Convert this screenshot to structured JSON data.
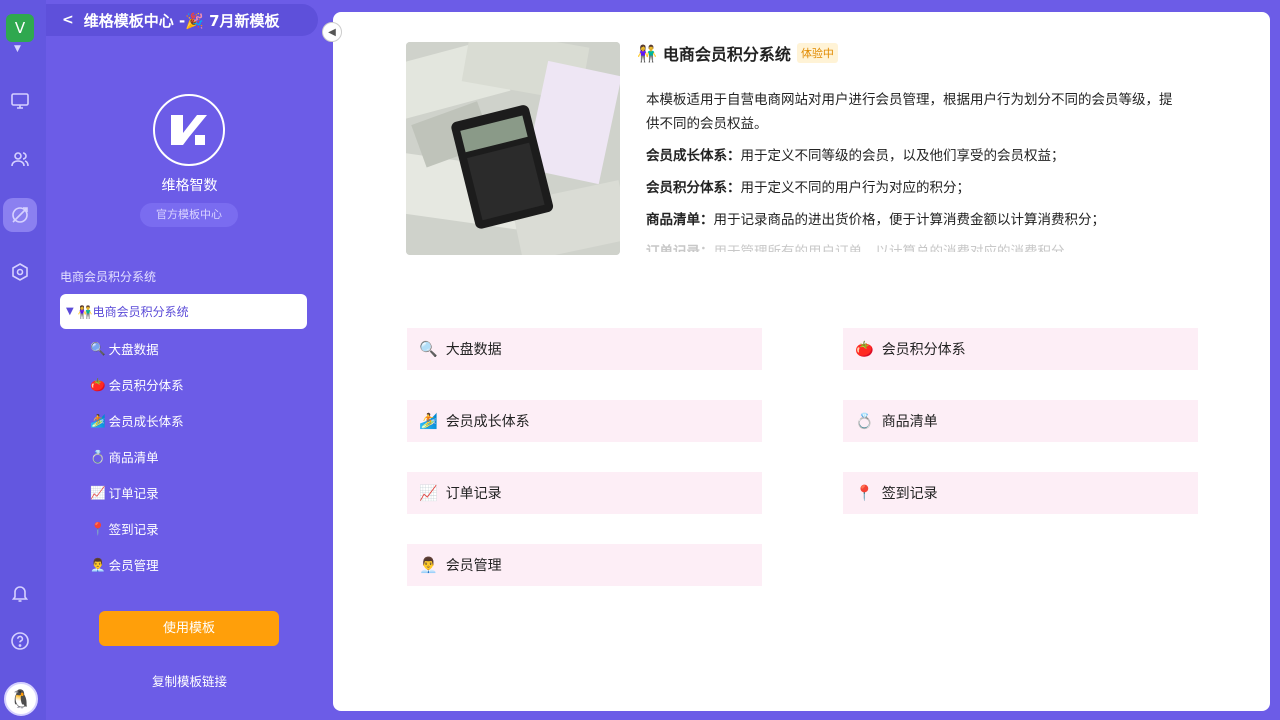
{
  "rail": {
    "workspace_initial": "V"
  },
  "side": {
    "title": "维格模板中心 -🎉 7月新模板",
    "brand_name": "维格智数",
    "brand_tag": "官方模板中心",
    "section_label": "电商会员积分系统",
    "tree_root": "电商会员积分系统",
    "tree_root_icon": "👫",
    "items": [
      {
        "icon": "🔍",
        "label": "大盘数据"
      },
      {
        "icon": "🍅",
        "label": "会员积分体系"
      },
      {
        "icon": "🏄",
        "label": "会员成长体系"
      },
      {
        "icon": "💍",
        "label": "商品清单"
      },
      {
        "icon": "📈",
        "label": "订单记录"
      },
      {
        "icon": "📍",
        "label": "签到记录"
      },
      {
        "icon": "👨‍💼",
        "label": "会员管理"
      }
    ],
    "use_button": "使用模板",
    "copy_link": "复制模板链接"
  },
  "main": {
    "title_icon": "👫",
    "title": "电商会员积分系统",
    "badge": "体验中",
    "intro": "本模板适用于自营电商网站对用户进行会员管理，根据用户行为划分不同的会员等级，提供不同的会员权益。",
    "features": [
      {
        "name": "会员成长体系：",
        "text": "用于定义不同等级的会员，以及他们享受的会员权益；"
      },
      {
        "name": "会员积分体系：",
        "text": "用于定义不同的用户行为对应的积分；"
      },
      {
        "name": "商品清单：",
        "text": "用于记录商品的进出货价格，便于计算消费金额以计算消费积分；"
      },
      {
        "name": "订单记录：",
        "text": "用于管理所有的用户订单，以计算总的消费对应的消费积分"
      }
    ],
    "cards": [
      {
        "icon": "🔍",
        "label": "大盘数据"
      },
      {
        "icon": "🍅",
        "label": "会员积分体系"
      },
      {
        "icon": "🏄",
        "label": "会员成长体系"
      },
      {
        "icon": "💍",
        "label": "商品清单"
      },
      {
        "icon": "📈",
        "label": "订单记录"
      },
      {
        "icon": "📍",
        "label": "签到记录"
      },
      {
        "icon": "👨‍💼",
        "label": "会员管理"
      }
    ]
  },
  "colors": {
    "brand_purple": "#6c5ce7",
    "accent_orange": "#ff9f0a",
    "card_pink": "#fdeef6",
    "badge_bg": "#fff3d6"
  }
}
